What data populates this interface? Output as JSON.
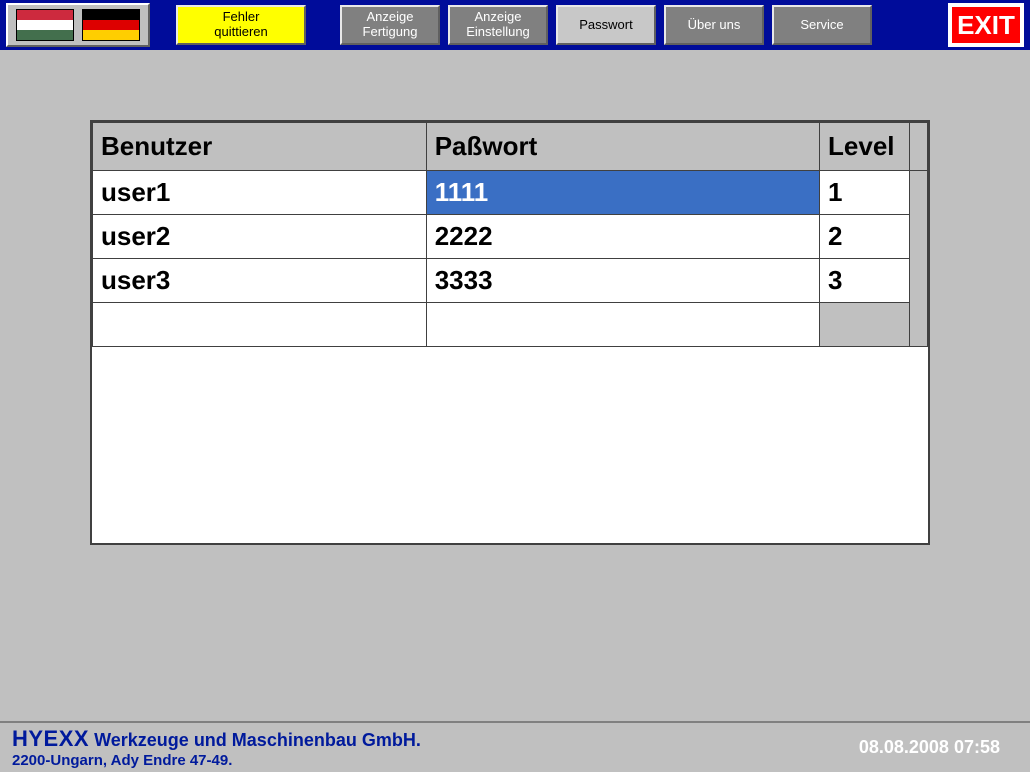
{
  "toolbar": {
    "quit_error": "Fehler\nquittieren",
    "display_production": "Anzeige\nFertigung",
    "display_settings": "Anzeige\nEinstellung",
    "password": "Passwort",
    "about": "Über uns",
    "service": "Service",
    "exit": "EXIT"
  },
  "table": {
    "headers": {
      "user": "Benutzer",
      "password": "Paßwort",
      "level": "Level"
    },
    "rows": [
      {
        "user": "user1",
        "password": "1111",
        "level": "1"
      },
      {
        "user": "user2",
        "password": "2222",
        "level": "2"
      },
      {
        "user": "user3",
        "password": "3333",
        "level": "3"
      }
    ],
    "selected": {
      "row": 0,
      "col": "password"
    }
  },
  "footer": {
    "company_big": "HYEXX",
    "company_rest": "Werkzeuge und Maschinenbau GmbH.",
    "address": "2200-Ungarn, Ady Endre 47-49.",
    "datetime": "08.08.2008 07:58"
  }
}
